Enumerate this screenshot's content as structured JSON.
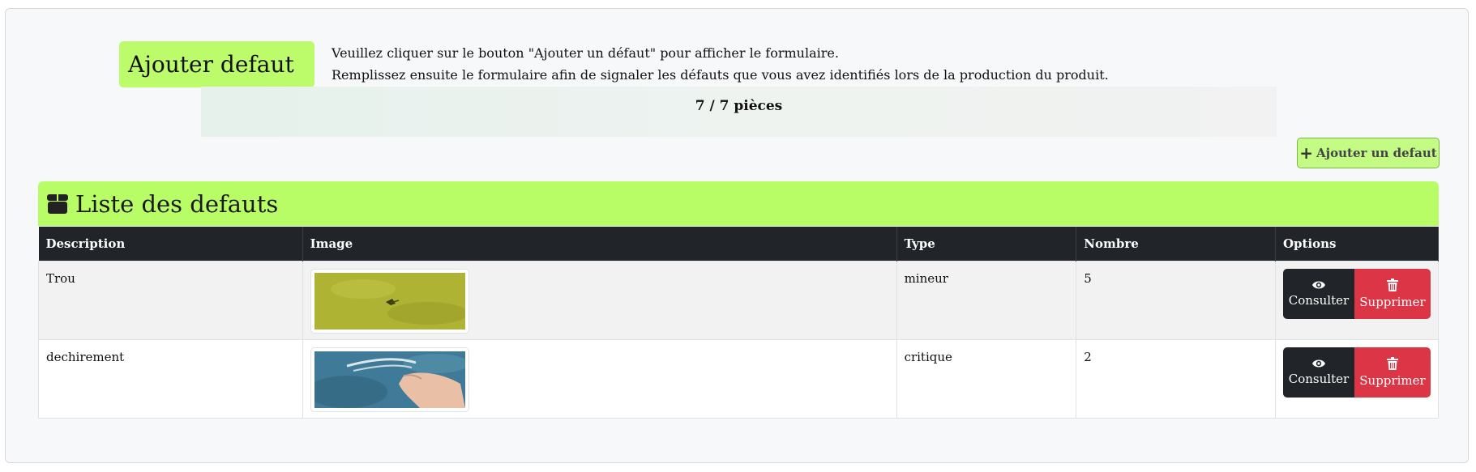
{
  "header": {
    "title": "Ajouter defaut",
    "intro_line1": "Veuillez cliquer sur le bouton \"Ajouter un défaut\" pour afficher le formulaire.",
    "intro_line2": "Remplissez ensuite le formulaire afin de signaler les défauts que vous avez identifiés lors de la production du produit.",
    "counter": "7 / 7 pièces",
    "add_button_label": "Ajouter un defaut",
    "add_button_icon": "plus-icon"
  },
  "list": {
    "title": "Liste des defauts",
    "title_icon": "box-icon",
    "columns": [
      "Description",
      "Image",
      "Type",
      "Nombre",
      "Options"
    ],
    "rows": [
      {
        "description": "Trou",
        "image_icon": "fabric-hole-thumbnail",
        "type": "mineur",
        "count": "5",
        "view_label": "Consulter",
        "delete_label": "Supprimer"
      },
      {
        "description": "dechirement",
        "image_icon": "denim-tear-thumbnail",
        "type": "critique",
        "count": "2",
        "view_label": "Consulter",
        "delete_label": "Supprimer"
      }
    ]
  },
  "colors": {
    "accent_green": "#bcfb6a",
    "table_header": "#212529",
    "danger": "#dc3545"
  }
}
